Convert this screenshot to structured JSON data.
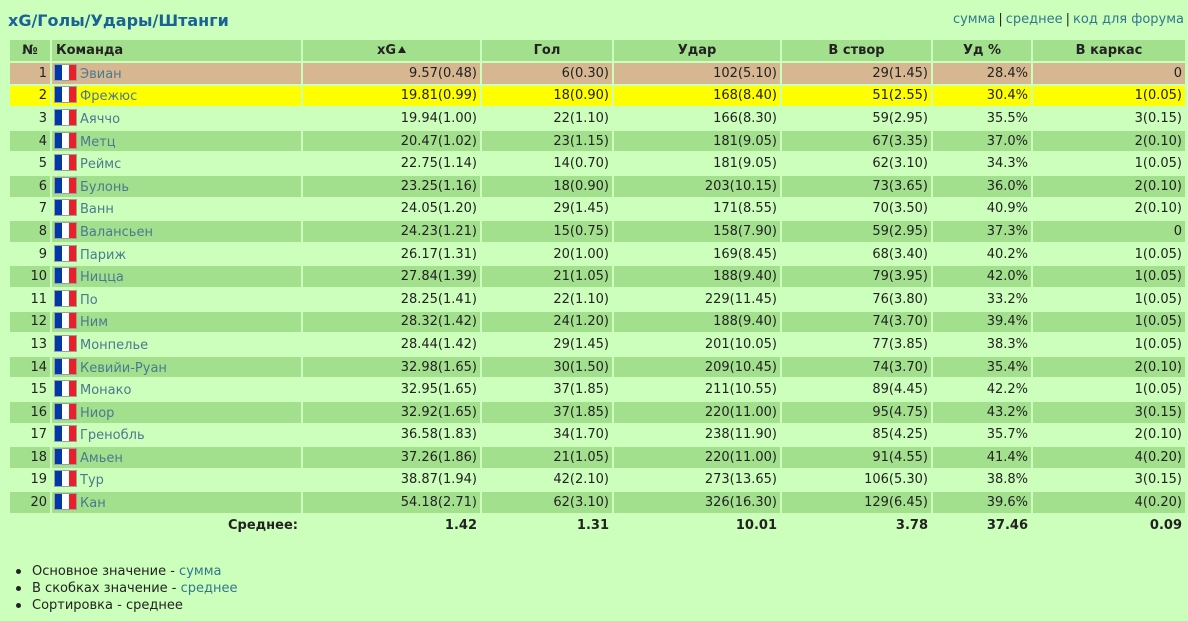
{
  "header": {
    "title": "xG/Голы/Удары/Штанги",
    "links": [
      {
        "id": "sum",
        "label": "сумма"
      },
      {
        "id": "avg",
        "label": "среднее"
      },
      {
        "id": "code",
        "label": "код для форума"
      }
    ],
    "sep": "|"
  },
  "table": {
    "columns": {
      "num": "№",
      "team": "Команда",
      "xg": "xG",
      "goals": "Гол",
      "shots": "Удар",
      "on_target": "В створ",
      "pct": "Уд %",
      "woodwork": "В каркас"
    },
    "rows": [
      {
        "n": "1",
        "team": "Эвиан",
        "xg": "9.57(0.48)",
        "goals": "6(0.30)",
        "shots": "102(5.10)",
        "on_target": "29(1.45)",
        "pct": "28.4%",
        "woodwork": "0"
      },
      {
        "n": "2",
        "team": "Фрежюс",
        "xg": "19.81(0.99)",
        "goals": "18(0.90)",
        "shots": "168(8.40)",
        "on_target": "51(2.55)",
        "pct": "30.4%",
        "woodwork": "1(0.05)"
      },
      {
        "n": "3",
        "team": "Аяччо",
        "xg": "19.94(1.00)",
        "goals": "22(1.10)",
        "shots": "166(8.30)",
        "on_target": "59(2.95)",
        "pct": "35.5%",
        "woodwork": "3(0.15)"
      },
      {
        "n": "4",
        "team": "Метц",
        "xg": "20.47(1.02)",
        "goals": "23(1.15)",
        "shots": "181(9.05)",
        "on_target": "67(3.35)",
        "pct": "37.0%",
        "woodwork": "2(0.10)"
      },
      {
        "n": "5",
        "team": "Реймс",
        "xg": "22.75(1.14)",
        "goals": "14(0.70)",
        "shots": "181(9.05)",
        "on_target": "62(3.10)",
        "pct": "34.3%",
        "woodwork": "1(0.05)"
      },
      {
        "n": "6",
        "team": "Булонь",
        "xg": "23.25(1.16)",
        "goals": "18(0.90)",
        "shots": "203(10.15)",
        "on_target": "73(3.65)",
        "pct": "36.0%",
        "woodwork": "2(0.10)"
      },
      {
        "n": "7",
        "team": "Ванн",
        "xg": "24.05(1.20)",
        "goals": "29(1.45)",
        "shots": "171(8.55)",
        "on_target": "70(3.50)",
        "pct": "40.9%",
        "woodwork": "2(0.10)"
      },
      {
        "n": "8",
        "team": "Валансьен",
        "xg": "24.23(1.21)",
        "goals": "15(0.75)",
        "shots": "158(7.90)",
        "on_target": "59(2.95)",
        "pct": "37.3%",
        "woodwork": "0"
      },
      {
        "n": "9",
        "team": "Париж",
        "xg": "26.17(1.31)",
        "goals": "20(1.00)",
        "shots": "169(8.45)",
        "on_target": "68(3.40)",
        "pct": "40.2%",
        "woodwork": "1(0.05)"
      },
      {
        "n": "10",
        "team": "Ницца",
        "xg": "27.84(1.39)",
        "goals": "21(1.05)",
        "shots": "188(9.40)",
        "on_target": "79(3.95)",
        "pct": "42.0%",
        "woodwork": "1(0.05)"
      },
      {
        "n": "11",
        "team": "По",
        "xg": "28.25(1.41)",
        "goals": "22(1.10)",
        "shots": "229(11.45)",
        "on_target": "76(3.80)",
        "pct": "33.2%",
        "woodwork": "1(0.05)"
      },
      {
        "n": "12",
        "team": "Ним",
        "xg": "28.32(1.42)",
        "goals": "24(1.20)",
        "shots": "188(9.40)",
        "on_target": "74(3.70)",
        "pct": "39.4%",
        "woodwork": "1(0.05)"
      },
      {
        "n": "13",
        "team": "Монпелье",
        "xg": "28.44(1.42)",
        "goals": "29(1.45)",
        "shots": "201(10.05)",
        "on_target": "77(3.85)",
        "pct": "38.3%",
        "woodwork": "1(0.05)"
      },
      {
        "n": "14",
        "team": "Кевийи-Руан",
        "xg": "32.98(1.65)",
        "goals": "30(1.50)",
        "shots": "209(10.45)",
        "on_target": "74(3.70)",
        "pct": "35.4%",
        "woodwork": "2(0.10)"
      },
      {
        "n": "15",
        "team": "Монако",
        "xg": "32.95(1.65)",
        "goals": "37(1.85)",
        "shots": "211(10.55)",
        "on_target": "89(4.45)",
        "pct": "42.2%",
        "woodwork": "1(0.05)"
      },
      {
        "n": "16",
        "team": "Ниор",
        "xg": "32.92(1.65)",
        "goals": "37(1.85)",
        "shots": "220(11.00)",
        "on_target": "95(4.75)",
        "pct": "43.2%",
        "woodwork": "3(0.15)"
      },
      {
        "n": "17",
        "team": "Гренобль",
        "xg": "36.58(1.83)",
        "goals": "34(1.70)",
        "shots": "238(11.90)",
        "on_target": "85(4.25)",
        "pct": "35.7%",
        "woodwork": "2(0.10)"
      },
      {
        "n": "18",
        "team": "Амьен",
        "xg": "37.26(1.86)",
        "goals": "21(1.05)",
        "shots": "220(11.00)",
        "on_target": "91(4.55)",
        "pct": "41.4%",
        "woodwork": "4(0.20)"
      },
      {
        "n": "19",
        "team": "Тур",
        "xg": "38.87(1.94)",
        "goals": "42(2.10)",
        "shots": "273(13.65)",
        "on_target": "106(5.30)",
        "pct": "38.8%",
        "woodwork": "3(0.15)"
      },
      {
        "n": "20",
        "team": "Кан",
        "xg": "54.18(2.71)",
        "goals": "62(3.10)",
        "shots": "326(16.30)",
        "on_target": "129(6.45)",
        "pct": "39.6%",
        "woodwork": "4(0.20)"
      }
    ],
    "summary": {
      "label": "Среднее:",
      "xg": "1.42",
      "goals": "1.31",
      "shots": "10.01",
      "on_target": "3.78",
      "pct": "37.46",
      "woodwork": "0.09"
    }
  },
  "legend": [
    {
      "text": "Основное значение - ",
      "link": "сумма",
      "is_link": true
    },
    {
      "text": "В скобках значение - ",
      "link": "среднее",
      "is_link": true
    },
    {
      "text": "Сортировка - среднее",
      "link": "",
      "is_link": false
    }
  ],
  "colors": {
    "background": "#ccffbb",
    "stripe": "#a3e08e",
    "selected_row": "#d6b791",
    "highlight_row": "#ffff00",
    "title": "#1a6296",
    "link": "#33778e",
    "team_link": "#4d7890",
    "flag_blue": "#0038a8",
    "flag_white": "#ffffff",
    "flag_red": "#e8202a"
  },
  "icons": {
    "flag": "france-flag-icon",
    "sort": "sort-ascending-icon"
  }
}
